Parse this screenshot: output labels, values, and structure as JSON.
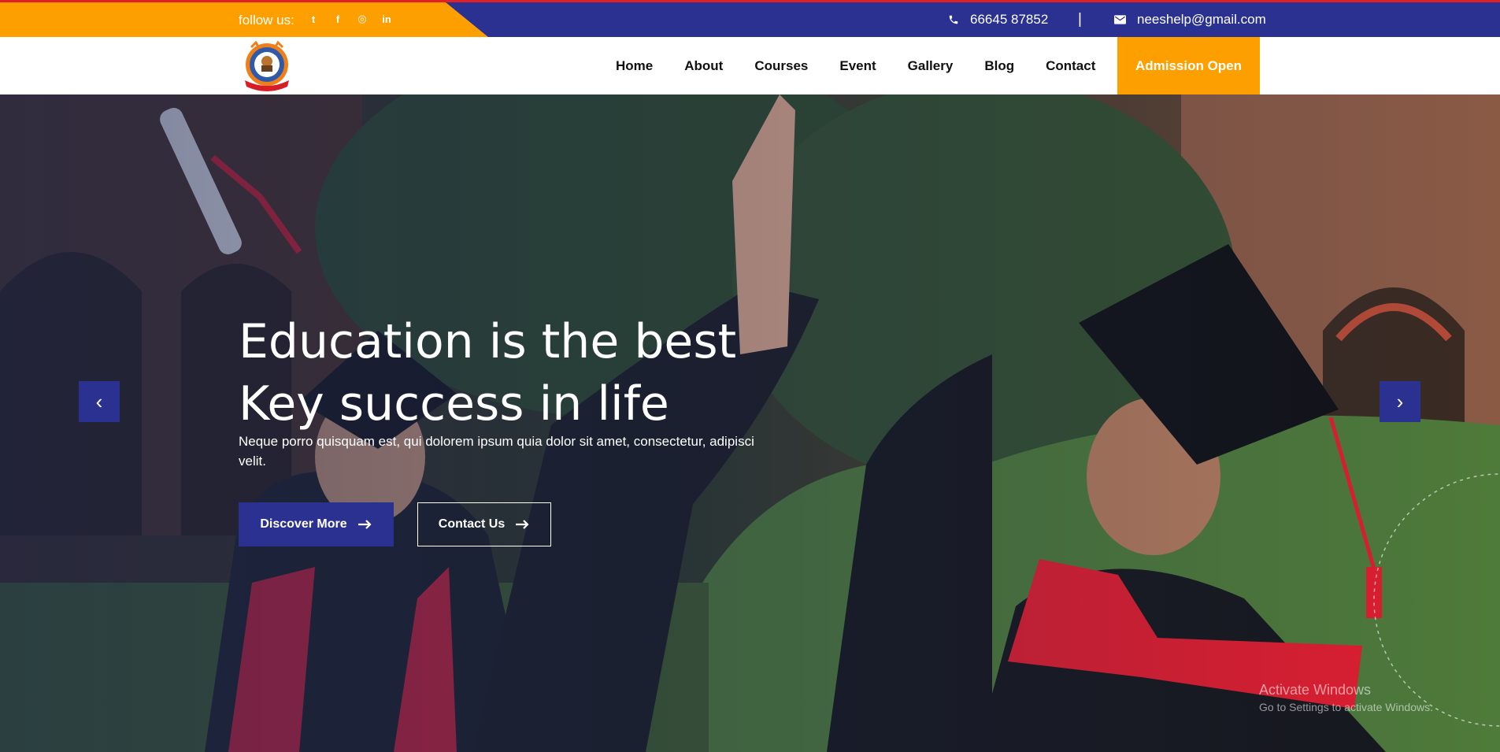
{
  "topbar": {
    "follow_label": "follow us:",
    "social": [
      {
        "icon": "twitter-icon",
        "glyph": "t"
      },
      {
        "icon": "facebook-icon",
        "glyph": "f"
      },
      {
        "icon": "instagram-icon",
        "glyph": "◎"
      },
      {
        "icon": "linkedin-icon",
        "glyph": "in"
      }
    ],
    "phone": "66645 87852",
    "separator": "|",
    "email": "neeshelp@gmail.com"
  },
  "nav": {
    "items": [
      "Home",
      "About",
      "Courses",
      "Event",
      "Gallery",
      "Blog",
      "Contact"
    ],
    "cta": "Admission Open"
  },
  "hero": {
    "title_line1": "Education is the best",
    "title_line2": "Key success in life",
    "subtitle": "Neque porro quisquam est, qui dolorem ipsum quia dolor sit amet, consectetur, adipisci velit.",
    "primary_button": "Discover More",
    "secondary_button": "Contact Us",
    "prev_glyph": "‹",
    "next_glyph": "›"
  },
  "watermark": {
    "title": "Activate Windows",
    "subtitle": "Go to Settings to activate Windows."
  },
  "colors": {
    "primary": "#2b3191",
    "accent": "#fe9f00",
    "topline": "#e11f26"
  }
}
